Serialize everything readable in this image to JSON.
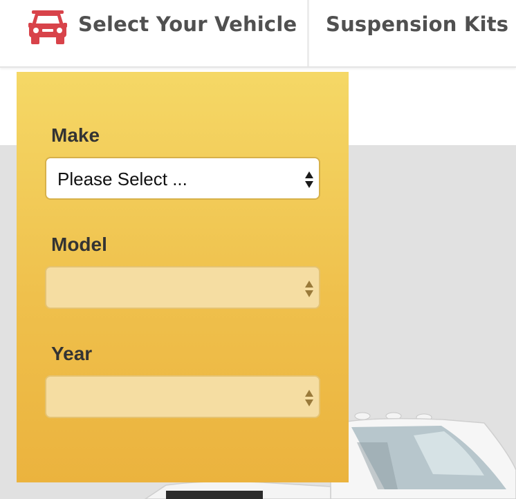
{
  "header": {
    "select_vehicle_label": "Select Your Vehicle",
    "suspension_kits_label": "Suspension Kits",
    "car_icon": "car-icon",
    "accent_color": "#d8434a"
  },
  "vehicle_selector": {
    "panel_colors": {
      "top": "#f5d866",
      "bottom": "#ebb33e"
    },
    "make": {
      "label": "Make",
      "value": "Please Select ...",
      "enabled": true
    },
    "model": {
      "label": "Model",
      "value": "",
      "enabled": false
    },
    "year": {
      "label": "Year",
      "value": "",
      "enabled": false
    }
  },
  "hero": {
    "image": "white-pickup-truck"
  }
}
